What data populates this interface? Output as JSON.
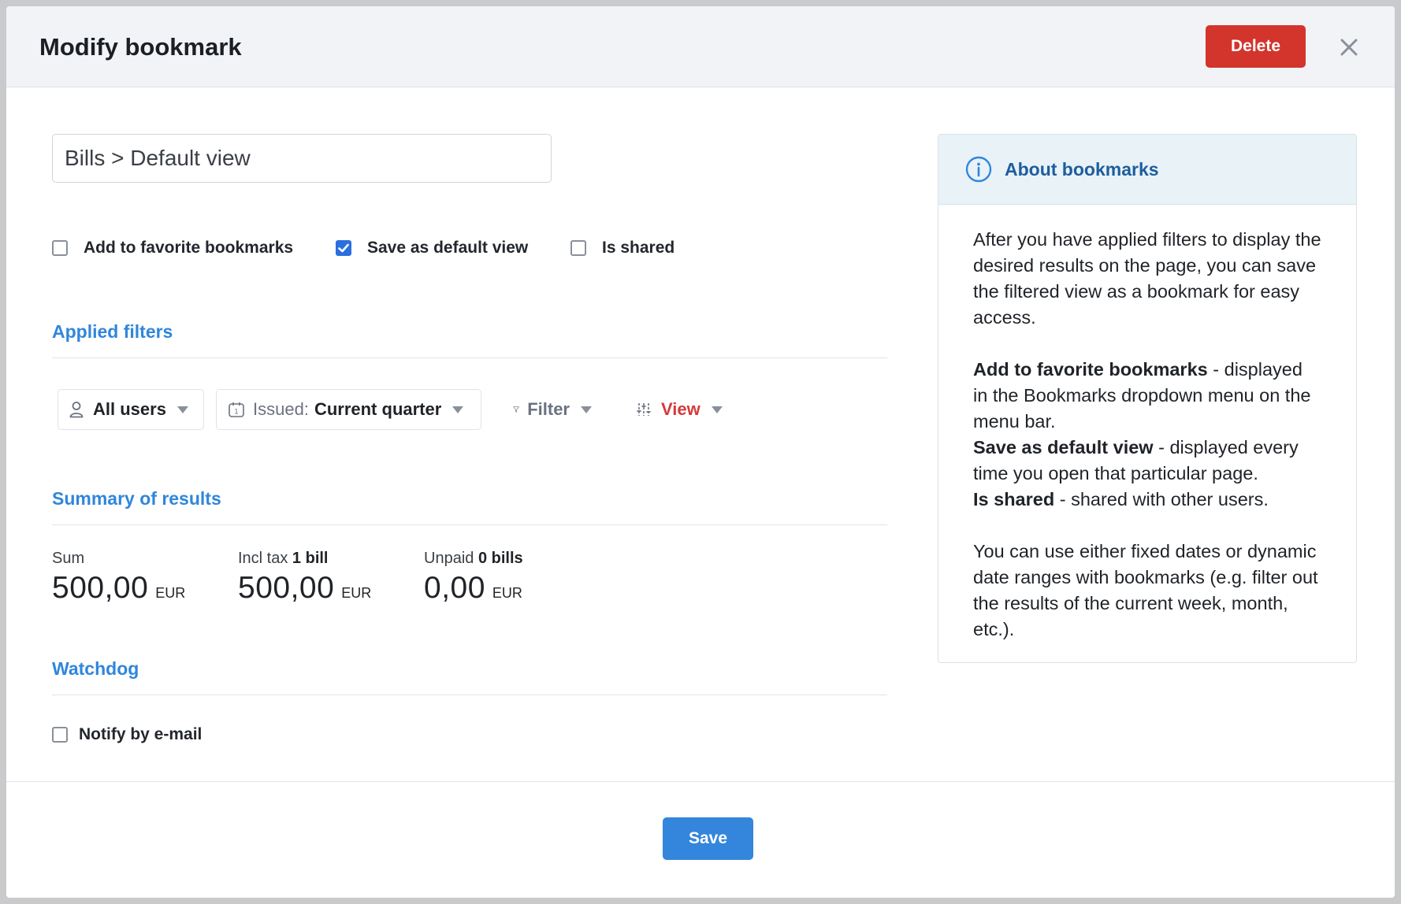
{
  "header": {
    "title": "Modify bookmark",
    "delete_label": "Delete"
  },
  "form": {
    "name_value": "Bills > Default view",
    "checkboxes": [
      {
        "label": "Add to favorite bookmarks",
        "checked": false
      },
      {
        "label": "Save as default view",
        "checked": true
      },
      {
        "label": "Is shared",
        "checked": false
      }
    ]
  },
  "applied_filters": {
    "title": "Applied filters",
    "users_label": "All users",
    "issued_prefix": "Issued:",
    "issued_value": "Current quarter",
    "filter_label": "Filter",
    "view_label": "View",
    "view_color": "#d33a3a"
  },
  "summary": {
    "title": "Summary of results",
    "items": [
      {
        "label": "Sum",
        "label_bold": "",
        "amount": "500,00",
        "currency": "EUR"
      },
      {
        "label": "Incl tax",
        "label_bold": "1 bill",
        "amount": "500,00",
        "currency": "EUR"
      },
      {
        "label": "Unpaid",
        "label_bold": "0 bills",
        "amount": "0,00",
        "currency": "EUR"
      }
    ]
  },
  "watchdog": {
    "title": "Watchdog",
    "notify_label": "Notify by e-mail",
    "notify_checked": false
  },
  "info": {
    "title": "About bookmarks",
    "intro": "After you have applied filters to display the desired results on the page, you can save the filtered view as a bookmark for easy access.",
    "favorite_term": "Add to favorite bookmarks",
    "favorite_desc": " - displayed in the Bookmarks dropdown menu on the menu bar.",
    "default_term": "Save as default view",
    "default_desc": " - displayed every time you open that particular page.",
    "shared_term": "Is shared",
    "shared_desc": " - shared with other users.",
    "dates": "You can use either fixed dates or dynamic date ranges with bookmarks (e.g. filter out the results of the current week, month, etc.)."
  },
  "footer": {
    "save_label": "Save"
  },
  "colors": {
    "primary": "#3386db",
    "danger": "#d3342c",
    "section_title": "#3086db"
  }
}
